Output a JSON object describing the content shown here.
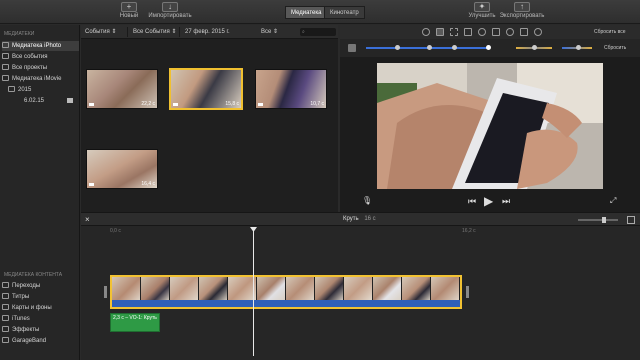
{
  "toolbar": {
    "new_label": "Новый",
    "import_label": "Импортировать",
    "tab_library": "Медиатека",
    "tab_theater": "Кинотеатр",
    "enhance_label": "Улучшить",
    "export_label": "Экспортировать"
  },
  "sidebar": {
    "libraries_header": "МЕДИАТЕКИ",
    "items": [
      {
        "label": "Медиатека iPhoto"
      },
      {
        "label": "Все события"
      },
      {
        "label": "Все проекты"
      },
      {
        "label": "Медиатека iMovie"
      },
      {
        "label": "2015"
      },
      {
        "label": "6.02.15"
      }
    ],
    "content_header": "МЕДИАТЕКА КОНТЕНТА",
    "content_items": [
      {
        "label": "Переходы"
      },
      {
        "label": "Титры"
      },
      {
        "label": "Карты и фоны"
      },
      {
        "label": "iTunes"
      },
      {
        "label": "Эффекты"
      },
      {
        "label": "GarageBand"
      }
    ]
  },
  "browser": {
    "events_label": "События",
    "all_events": "Все События",
    "date": "27 февр. 2015 г.",
    "filter": "Все",
    "search_placeholder": "",
    "clips": [
      {
        "duration": "22,2 с"
      },
      {
        "duration": "15,8 с"
      },
      {
        "duration": "10,7 с"
      },
      {
        "duration": "16,4 с"
      }
    ]
  },
  "viewer": {
    "reset_all": "Сбросить все",
    "reset": "Сбросить"
  },
  "timeline": {
    "title": "Круть",
    "duration": "16 с",
    "tick_start": "0,0 с",
    "tick_end": "16,2 с",
    "audio_clip_label": "2,3 с – VO-1: Круть"
  },
  "colors": {
    "selection": "#f2c232",
    "audio": "#2e9a45",
    "waveform": "#2f5fb8",
    "slider_accent": "#3a6fd8"
  }
}
